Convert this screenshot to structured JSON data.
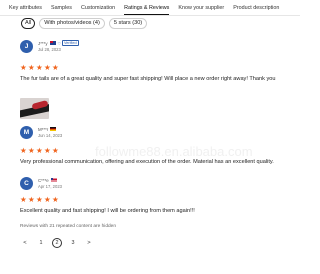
{
  "tabs": [
    "Key attributes",
    "Samples",
    "Customization",
    "Ratings & Reviews",
    "Know your supplier",
    "Product description"
  ],
  "filters": [
    "All",
    "With photos/videos (4)",
    "5 stars (30)"
  ],
  "watermark": "followme88.en.alibaba.com",
  "reviews": [
    {
      "initial": "J",
      "name": "J***y",
      "flag": "flag-au",
      "badge": "Verified",
      "date": "Jul 28, 2023",
      "rating": 5,
      "text": "The fur tails are of a great quality and super fast shipping! Will place a new order right away! Thank you"
    },
    {
      "initial": "M",
      "name": "M***r",
      "flag": "flag-de",
      "date": "Jun 14, 2023",
      "rating": 5,
      "text": "Very professional communication, offering and execution of the order. Material has an excellent quality."
    },
    {
      "initial": "C",
      "name": "C***e",
      "flag": "flag-us",
      "date": "Apr 17, 2023",
      "rating": 5,
      "text": "Excellent quality and fast shipping! I will be ordering from them again!!!"
    }
  ],
  "hidden_note": "Reviews with 21 repeated content are hidden",
  "pagination": {
    "pages": [
      "1",
      "2",
      "3"
    ],
    "current": "2",
    "prev": "<",
    "next": ">"
  },
  "colors": {
    "star": "#f0651f",
    "avatar": "#2f5fad"
  }
}
